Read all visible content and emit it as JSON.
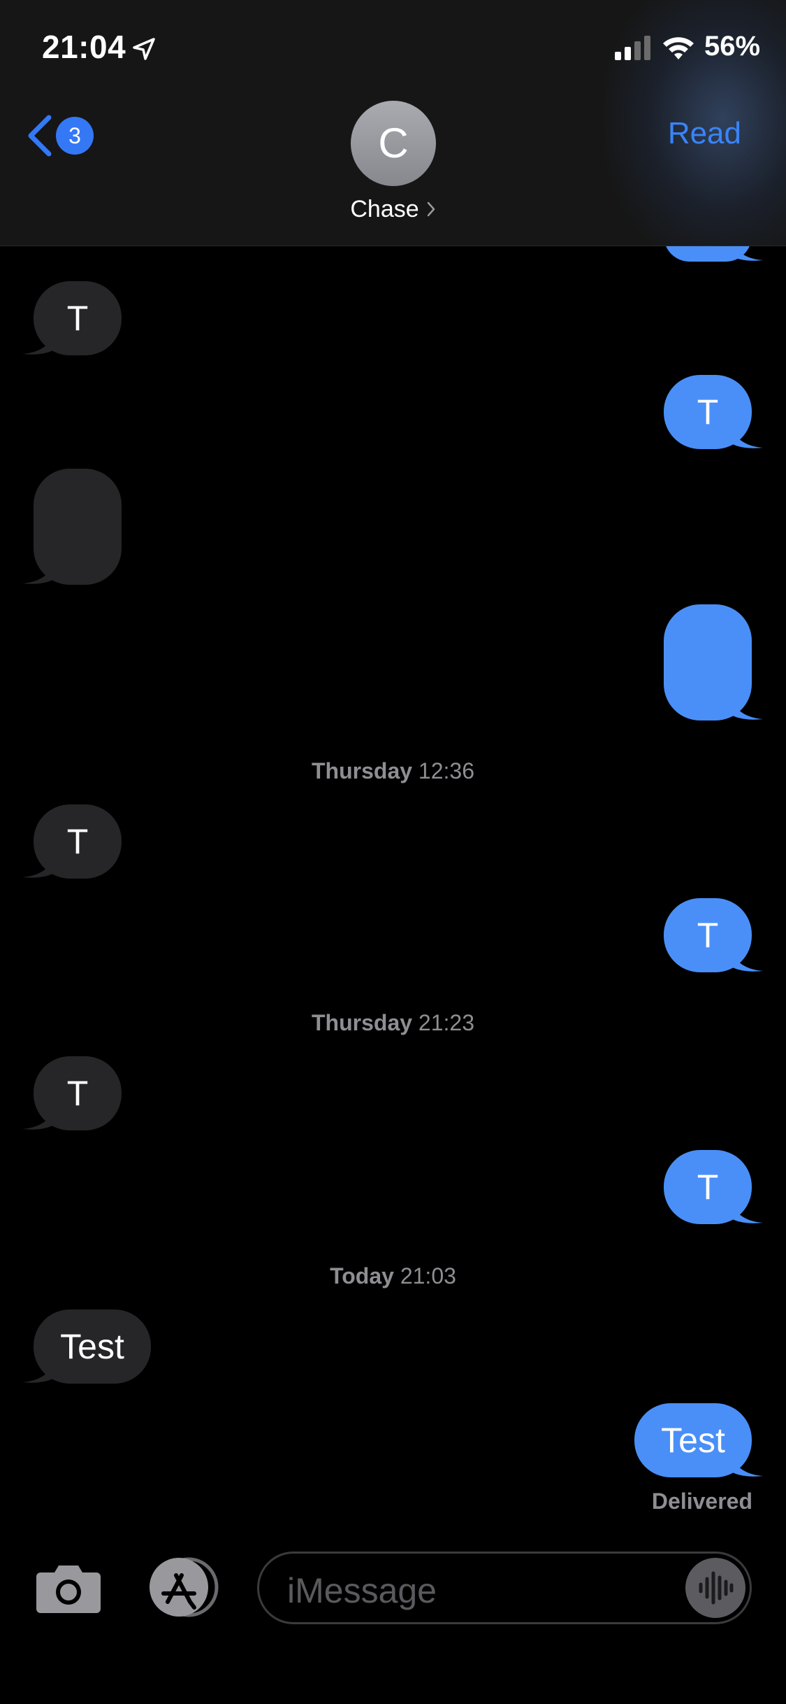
{
  "status_bar": {
    "time": "21:04",
    "battery_percent": "56%",
    "icons": [
      "location-arrow-icon",
      "signal-icon",
      "wifi-icon"
    ]
  },
  "header": {
    "back_badge_count": "3",
    "avatar_initial": "C",
    "contact_name": "Chase",
    "read_label": "Read"
  },
  "messages": [
    {
      "direction": "in",
      "text": "T"
    },
    {
      "direction": "out",
      "text": "T"
    },
    {
      "direction": "in",
      "text": ""
    },
    {
      "direction": "out",
      "text": ""
    },
    {
      "direction": "in",
      "text": "T"
    },
    {
      "direction": "out",
      "text": "T"
    },
    {
      "direction": "in",
      "text": "T"
    },
    {
      "direction": "out",
      "text": "T"
    },
    {
      "direction": "in",
      "text": "Test"
    },
    {
      "direction": "out",
      "text": "Test"
    }
  ],
  "timestamps": [
    {
      "day": "Thursday",
      "time": "12:36"
    },
    {
      "day": "Thursday",
      "time": "21:23"
    },
    {
      "day": "Today",
      "time": "21:03"
    }
  ],
  "delivery_status": "Delivered",
  "input_bar": {
    "placeholder": "iMessage",
    "icons": [
      "camera-icon",
      "app-store-icon",
      "audio-waveform-icon"
    ]
  },
  "colors": {
    "incoming_bubble": "#262628",
    "outgoing_bubble": "#4a8ff7",
    "accent": "#3478f6",
    "background": "#000000"
  }
}
